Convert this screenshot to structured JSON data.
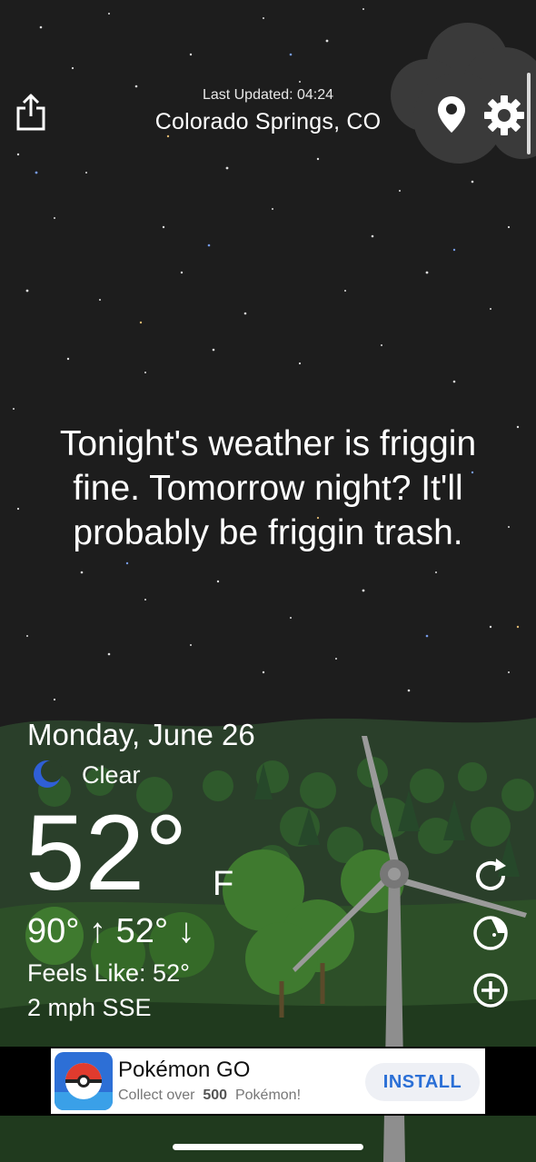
{
  "header": {
    "last_updated": "Last Updated: 04:24",
    "location": "Colorado Springs, CO",
    "icons": {
      "share": "share-icon",
      "location": "location-pin-icon",
      "settings": "gear-icon"
    }
  },
  "message": "Tonight's weather is friggin fine. Tomorrow night? It'll probably be friggin trash.",
  "current": {
    "date": "Monday, June 26",
    "condition_icon": "moon-icon",
    "condition": "Clear",
    "temperature": "52°",
    "unit": "F",
    "hi_lo": "90° ↑ 52° ↓",
    "feels_like": "Feels Like: 52°",
    "wind": "2 mph SSE"
  },
  "side_actions": [
    {
      "icon": "refresh-icon"
    },
    {
      "icon": "radar-icon"
    },
    {
      "icon": "add-location-icon"
    }
  ],
  "ad": {
    "title": "Pokémon GO",
    "subtitle_pre": "Collect over",
    "subtitle_num": "500",
    "subtitle_post": "Pokémon!",
    "install": "INSTALL"
  },
  "colors": {
    "sky": "#1d1d1d",
    "grass_dark": "#1f3a1d",
    "tree_green": "#3f7a2f",
    "install_text": "#2a6fd6"
  }
}
